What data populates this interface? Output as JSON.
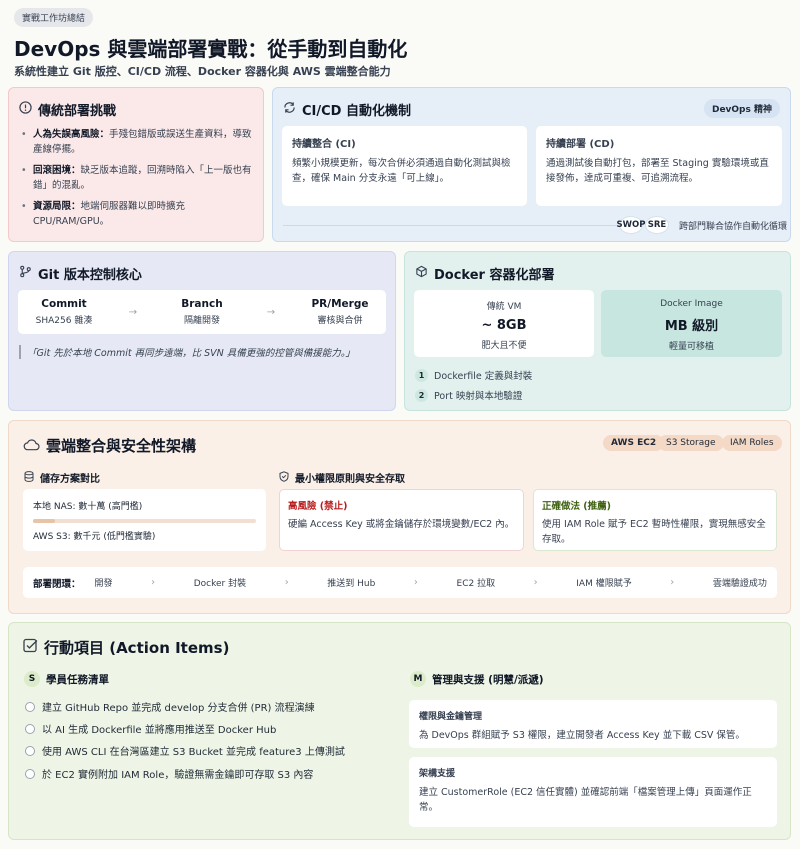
{
  "header": {
    "tag": "實戰工作坊總結",
    "title": "DevOps 與雲端部署實戰：從手動到自動化",
    "subtitle": "系統性建立 Git 版控、CI/CD 流程、Docker 容器化與 AWS 雲端整合能力"
  },
  "challenges": {
    "title": "傳統部署挑戰",
    "items": [
      {
        "term": "人為失誤高風險：",
        "desc": "手殘包錯版或誤送生產資料，導致產線停擺。"
      },
      {
        "term": "回滾困境：",
        "desc": "缺乏版本追蹤，回溯時陷入「上一版也有錯」的混亂。"
      },
      {
        "term": "資源局限：",
        "desc": "地端伺服器難以即時擴充 CPU/RAM/GPU。"
      }
    ]
  },
  "cicd": {
    "title": "CI/CD 自動化機制",
    "badge": "DevOps 精神",
    "ci": {
      "title": "持續整合 (CI)",
      "desc": "頻繁小規模更新，每次合併必須通過自動化測試與檢查，確保 Main 分支永遠「可上線」。"
    },
    "cd": {
      "title": "持續部署 (CD)",
      "desc": "通過測試後自動打包，部署至 Staging 實驗環境或直接發佈，達成可重複、可追溯流程。"
    },
    "roles": [
      "SWOP",
      "SRE"
    ],
    "roles_note": "跨部門聯合協作自動化循環"
  },
  "git": {
    "title": "Git 版本控制核心",
    "flow": [
      {
        "name": "Commit",
        "desc": "SHA256 雜湊"
      },
      {
        "name": "Branch",
        "desc": "隔離開發"
      },
      {
        "name": "PR/Merge",
        "desc": "審核與合併"
      }
    ],
    "quote": "「Git 先於本地 Commit 再同步遠端，比 SVN 具備更強的控管與備援能力。」"
  },
  "docker": {
    "title": "Docker 容器化部署",
    "vm": {
      "label": "傳統 VM",
      "value": "~ 8GB",
      "note": "肥大且不便"
    },
    "image": {
      "label": "Docker Image",
      "value": "MB 級別",
      "note": "輕量可移植"
    },
    "steps": [
      {
        "n": "1",
        "text": "Dockerfile 定義與封裝"
      },
      {
        "n": "2",
        "text": "Port 映射與本地驗證"
      }
    ]
  },
  "cloud": {
    "title": "雲端整合與安全性架構",
    "tags": [
      "AWS EC2",
      "S3 Storage",
      "IAM Roles"
    ],
    "storage": {
      "title": "儲存方案對比",
      "nas": "本地 NAS: 數十萬 (高門檻)",
      "s3": "AWS S3: 數千元 (低門檻實驗)"
    },
    "security": {
      "title": "最小權限原則與安全存取",
      "bad": {
        "title": "高風險 (禁止)",
        "desc": "硬編 Access Key 或將金鑰儲存於環境變數/EC2 內。"
      },
      "good": {
        "title": "正確做法 (推薦)",
        "desc": "使用 IAM Role 賦予 EC2 暫時性權限，實現無感安全存取。"
      }
    },
    "pipeline": {
      "label": "部署閉環：",
      "steps": [
        "開發",
        "Docker 封裝",
        "推送到 Hub",
        "EC2 拉取",
        "IAM 權限賦予",
        "雲端驗證成功"
      ]
    }
  },
  "actions": {
    "title": "行動項目 (Action Items)",
    "students": {
      "badge": "S",
      "title": "學員任務清單",
      "items": [
        "建立 GitHub Repo 並完成 develop 分支合併 (PR) 流程演練",
        "以 AI 生成 Dockerfile 並將應用推送至 Docker Hub",
        "使用 AWS CLI 在台灣區建立 S3 Bucket 並完成 feature3 上傳測試",
        "於 EC2 實例附加 IAM Role，驗證無需金鑰即可存取 S3 內容"
      ]
    },
    "managers": {
      "badge": "M",
      "title": "管理與支援 (明慧/派遞)",
      "cards": [
        {
          "title": "權限與金鑰管理",
          "desc": "為 DevOps 群組賦予 S3 權限，建立開發者 Access Key 並下載 CSV 保管。"
        },
        {
          "title": "架構支援",
          "desc": "建立 CustomerRole (EC2 信任實體) 並確認前端「檔案管理上傳」頁面運作正常。"
        }
      ]
    }
  }
}
